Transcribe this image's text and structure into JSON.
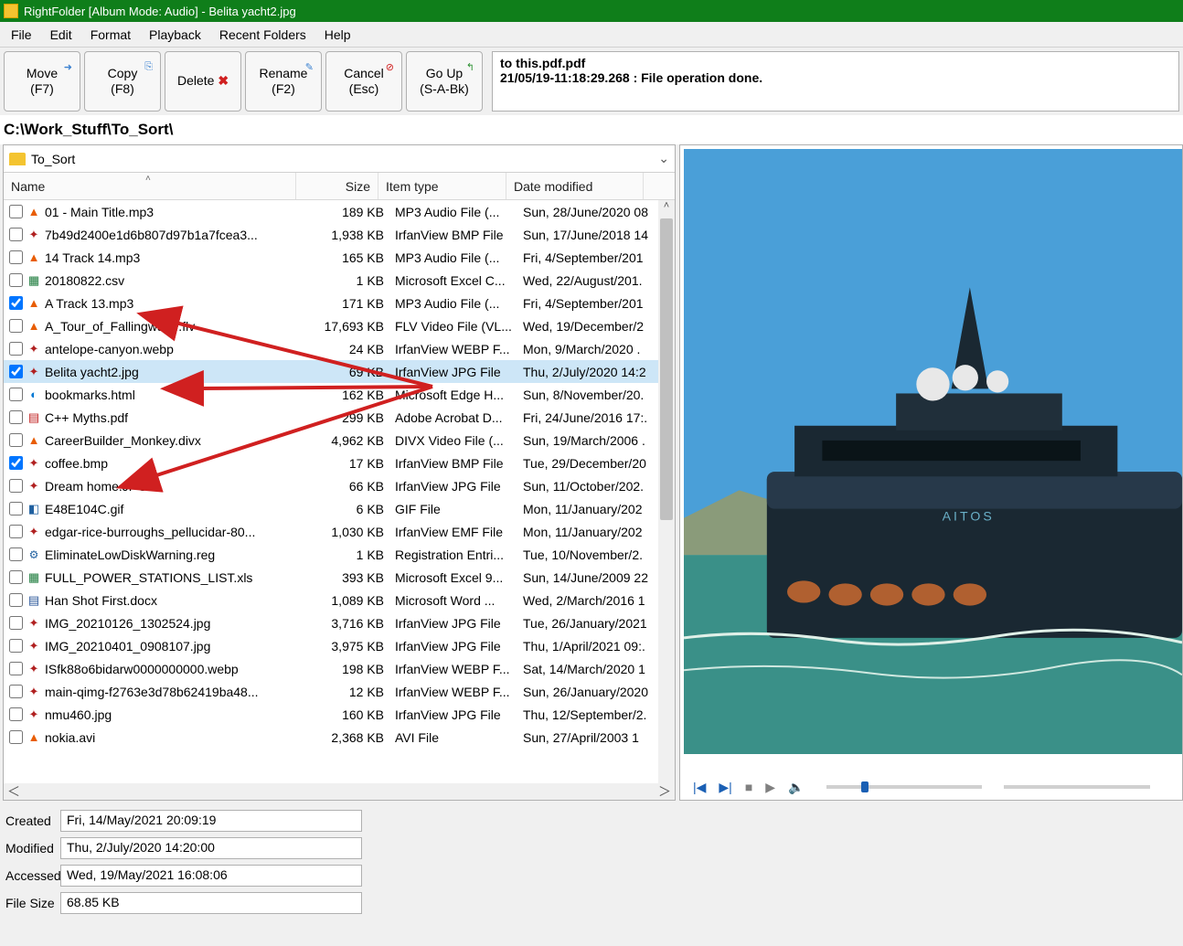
{
  "title": "RightFolder [Album Mode: Audio] - Belita yacht2.jpg",
  "menu": [
    "File",
    "Edit",
    "Format",
    "Playback",
    "Recent Folders",
    "Help"
  ],
  "toolbar": [
    {
      "label": "Move",
      "shortcut": "(F7)",
      "icon": "➜"
    },
    {
      "label": "Copy",
      "shortcut": "(F8)",
      "icon": "⎘"
    },
    {
      "label": "Delete",
      "shortcut": "",
      "icon": "✖",
      "iconColor": "#d02020"
    },
    {
      "label": "Rename",
      "shortcut": "(F2)",
      "icon": "✎"
    },
    {
      "label": "Cancel",
      "shortcut": "(Esc)",
      "icon": "⊘",
      "iconColor": "#d02020"
    },
    {
      "label": "Go Up",
      "shortcut": "(S-A-Bk)",
      "icon": "↰",
      "iconColor": "#2a9030"
    }
  ],
  "log": {
    "l1": "to  this.pdf.pdf",
    "l2": "21/05/19-11:18:29.268 : File operation done."
  },
  "path": "C:\\Work_Stuff\\To_Sort\\",
  "folder_name": "To_Sort",
  "columns": {
    "name": "Name",
    "size": "Size",
    "type": "Item type",
    "date": "Date modified"
  },
  "files": [
    {
      "chk": false,
      "ico": "vlc",
      "name": "01 - Main Title.mp3",
      "size": "189 KB",
      "type": "MP3 Audio File (...",
      "date": "Sun, 28/June/2020 08"
    },
    {
      "chk": false,
      "ico": "irfan",
      "name": "7b49d2400e1d6b807d97b1a7fcea3...",
      "size": "1,938 KB",
      "type": "IrfanView BMP File",
      "date": "Sun, 17/June/2018 14"
    },
    {
      "chk": false,
      "ico": "vlc",
      "name": "14 Track 14.mp3",
      "size": "165 KB",
      "type": "MP3 Audio File (...",
      "date": "Fri, 4/September/201"
    },
    {
      "chk": false,
      "ico": "xls",
      "name": "20180822.csv",
      "size": "1 KB",
      "type": "Microsoft Excel C...",
      "date": "Wed, 22/August/201."
    },
    {
      "chk": true,
      "ico": "vlc",
      "name": "A Track 13.mp3",
      "size": "171 KB",
      "type": "MP3 Audio File (...",
      "date": "Fri, 4/September/201"
    },
    {
      "chk": false,
      "ico": "vlc",
      "name": "A_Tour_of_Fallingwater.flv",
      "size": "17,693 KB",
      "type": "FLV Video File (VL...",
      "date": "Wed, 19/December/2"
    },
    {
      "chk": false,
      "ico": "irfan",
      "name": "antelope-canyon.webp",
      "size": "24 KB",
      "type": "IrfanView WEBP F...",
      "date": "Mon, 9/March/2020 ."
    },
    {
      "chk": true,
      "ico": "irfan",
      "name": "Belita yacht2.jpg",
      "size": "69 KB",
      "type": "IrfanView JPG File",
      "date": "Thu, 2/July/2020 14:2",
      "sel": true
    },
    {
      "chk": false,
      "ico": "edge",
      "name": "bookmarks.html",
      "size": "162 KB",
      "type": "Microsoft Edge H...",
      "date": "Sun, 8/November/20."
    },
    {
      "chk": false,
      "ico": "pdf",
      "name": "C++ Myths.pdf",
      "size": "299 KB",
      "type": "Adobe Acrobat D...",
      "date": "Fri, 24/June/2016 17:."
    },
    {
      "chk": false,
      "ico": "vlc",
      "name": "CareerBuilder_Monkey.divx",
      "size": "4,962 KB",
      "type": "DIVX Video File (...",
      "date": "Sun, 19/March/2006 ."
    },
    {
      "chk": true,
      "ico": "irfan",
      "name": "coffee.bmp",
      "size": "17 KB",
      "type": "IrfanView BMP File",
      "date": "Tue, 29/December/20"
    },
    {
      "chk": false,
      "ico": "irfan",
      "name": "Dream home.JPG",
      "size": "66 KB",
      "type": "IrfanView JPG File",
      "date": "Sun, 11/October/202."
    },
    {
      "chk": false,
      "ico": "gif",
      "name": "E48E104C.gif",
      "size": "6 KB",
      "type": "GIF File",
      "date": "Mon, 11/January/202"
    },
    {
      "chk": false,
      "ico": "irfan",
      "name": "edgar-rice-burroughs_pellucidar-80...",
      "size": "1,030 KB",
      "type": "IrfanView EMF File",
      "date": "Mon, 11/January/202"
    },
    {
      "chk": false,
      "ico": "reg",
      "name": "EliminateLowDiskWarning.reg",
      "size": "1 KB",
      "type": "Registration Entri...",
      "date": "Tue, 10/November/2."
    },
    {
      "chk": false,
      "ico": "xls",
      "name": "FULL_POWER_STATIONS_LIST.xls",
      "size": "393 KB",
      "type": "Microsoft Excel 9...",
      "date": "Sun, 14/June/2009 22"
    },
    {
      "chk": false,
      "ico": "doc",
      "name": "Han Shot First.docx",
      "size": "1,089 KB",
      "type": "Microsoft Word ...",
      "date": "Wed, 2/March/2016 1"
    },
    {
      "chk": false,
      "ico": "irfan",
      "name": "IMG_20210126_1302524.jpg",
      "size": "3,716 KB",
      "type": "IrfanView JPG File",
      "date": "Tue, 26/January/2021"
    },
    {
      "chk": false,
      "ico": "irfan",
      "name": "IMG_20210401_0908107.jpg",
      "size": "3,975 KB",
      "type": "IrfanView JPG File",
      "date": "Thu, 1/April/2021 09:."
    },
    {
      "chk": false,
      "ico": "irfan",
      "name": "ISfk88o6bidarw0000000000.webp",
      "size": "198 KB",
      "type": "IrfanView WEBP F...",
      "date": "Sat, 14/March/2020 1"
    },
    {
      "chk": false,
      "ico": "irfan",
      "name": "main-qimg-f2763e3d78b62419ba48...",
      "size": "12 KB",
      "type": "IrfanView WEBP F...",
      "date": "Sun, 26/January/2020"
    },
    {
      "chk": false,
      "ico": "irfan",
      "name": "nmu460.jpg",
      "size": "160 KB",
      "type": "IrfanView JPG File",
      "date": "Thu, 12/September/2."
    },
    {
      "chk": false,
      "ico": "vlc",
      "name": "nokia.avi",
      "size": "2,368 KB",
      "type": "AVI File",
      "date": "Sun, 27/April/2003 1"
    }
  ],
  "status": {
    "created_lbl": "Created",
    "created": "Fri, 14/May/2021 20:09:19",
    "modified_lbl": "Modified",
    "modified": "Thu, 2/July/2020 14:20:00",
    "accessed_lbl": "Accessed",
    "accessed": "Wed, 19/May/2021 16:08:06",
    "filesize_lbl": "File Size",
    "filesize": "68.85 KB"
  }
}
